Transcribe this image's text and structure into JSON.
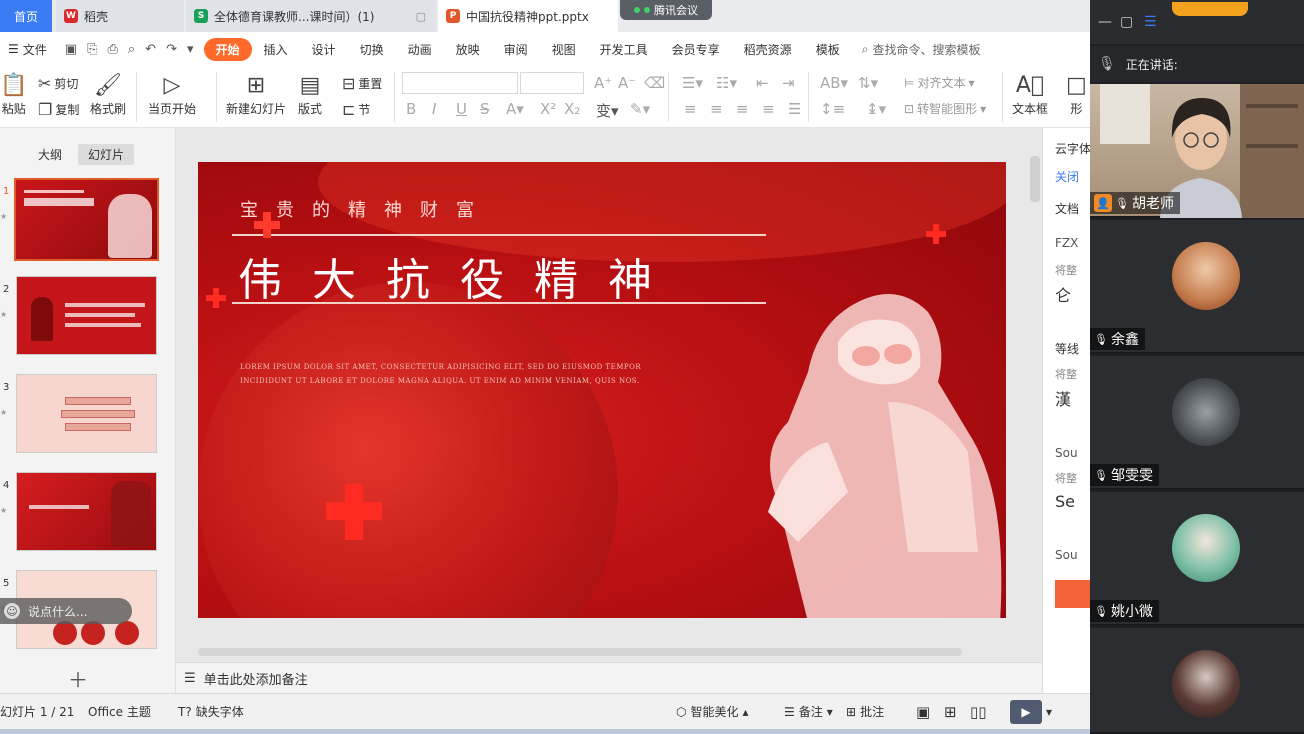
{
  "titlebar": {
    "home": "首页",
    "tabs": [
      {
        "label": "稻壳",
        "icon": "daoke-logo-icon",
        "color": "#d92b2b"
      },
      {
        "label": "全体德育课教师...课时间）(1)",
        "icon": "sheet-icon",
        "color": "#18a058"
      },
      {
        "label": "中国抗役精神ppt.pptx",
        "icon": "ppt-icon",
        "color": "#e2582b"
      }
    ],
    "meeting_pill": "腾讯会议"
  },
  "menubar": {
    "file": "文件",
    "tabs": [
      "开始",
      "插入",
      "设计",
      "切换",
      "动画",
      "放映",
      "审阅",
      "视图",
      "开发工具",
      "会员专享",
      "稻壳资源",
      "模板"
    ],
    "active_tab": "开始",
    "search": "查找命令、搜索模板"
  },
  "toolbar": {
    "paste": "粘贴",
    "cut": "剪切",
    "copy": "复制",
    "format_painter": "格式刷",
    "from_current": "当页开始",
    "new_slide": "新建幻灯片",
    "layout": "版式",
    "reset": "重置",
    "section": "节",
    "align_text": "对齐文本",
    "smart_shape": "转智能图形",
    "textbox": "文本框",
    "shape": "形"
  },
  "leftpanel": {
    "tabs": [
      "大纲",
      "幻灯片"
    ],
    "active_tab": "幻灯片",
    "slide_numbers": [
      "1",
      "2",
      "3",
      "4",
      "5"
    ],
    "say_placeholder": "说点什么..."
  },
  "slide": {
    "kicker": "宝贵的精神财富",
    "title": "伟大抗役精神",
    "lorem": "LOREM IPSUM DOLOR SIT AMET, CONSECTETUR ADIPISICING ELIT, SED DO EIUSMOD TEMPOR INCIDIDUNT UT LABORE ET DOLORE MAGNA ALIQUA. UT ENIM AD MINIM VENIAM, QUIS NOS."
  },
  "notes": "单击此处添加备注",
  "rightpanel": {
    "items": [
      "云字体",
      "关闭",
      "文档",
      "FZX",
      "将整",
      "仑",
      "等线",
      "将整",
      "漢",
      "Sou",
      "将整",
      "Se",
      "Sou"
    ]
  },
  "statusbar": {
    "slide_info": "幻灯片 1 / 21",
    "theme": "Office 主题",
    "missing_font": "缺失字体",
    "beautify": "智能美化",
    "notes": "备注",
    "comments": "批注"
  },
  "meeting": {
    "speaking": "正在讲话:",
    "participants": [
      {
        "name": "胡老师",
        "host": true
      },
      {
        "name": "余鑫"
      },
      {
        "name": "邹雯雯"
      },
      {
        "name": "姚小微"
      },
      {
        "name": ""
      }
    ]
  },
  "colors": {
    "accent": "#ff6a2b",
    "slide_red": "#c8161a",
    "home_blue": "#3b7cf5"
  }
}
